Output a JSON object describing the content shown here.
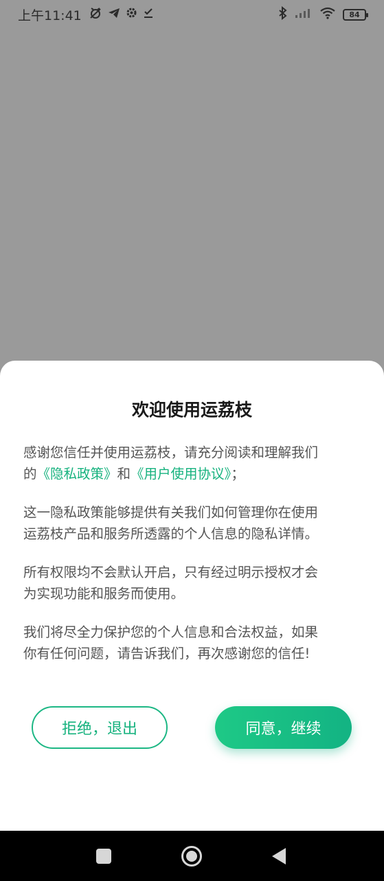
{
  "status_bar": {
    "time": "上午11:41",
    "battery": "84"
  },
  "dialog": {
    "title": "欢迎使用运荔枝",
    "p1_line1": "感谢您信任并使用运荔枝，请充分阅读和理解我们",
    "p1_pre": "的",
    "privacy_link": "《隐私政策》",
    "p1_mid": "和",
    "terms_link": "《用户使用协议》",
    "p1_end": "；",
    "p2_line1": "这一隐私政策能够提供有关我们如何管理你在使用",
    "p2_line2": "运荔枝产品和服务所透露的个人信息的隐私详情。",
    "p3_line1": "所有权限均不会默认开启，只有经过明示授权才会",
    "p3_line2": "为实现功能和服务而使用。",
    "p4_line1": "我们将尽全力保护您的个人信息和合法权益，如果",
    "p4_line2": "你有任何问题，请告诉我们，再次感谢您的信任!",
    "decline_label": "拒绝，退出",
    "accept_label": "同意，继续"
  },
  "colors": {
    "accent": "#16b27e",
    "overlay": "#9a9a9a"
  }
}
